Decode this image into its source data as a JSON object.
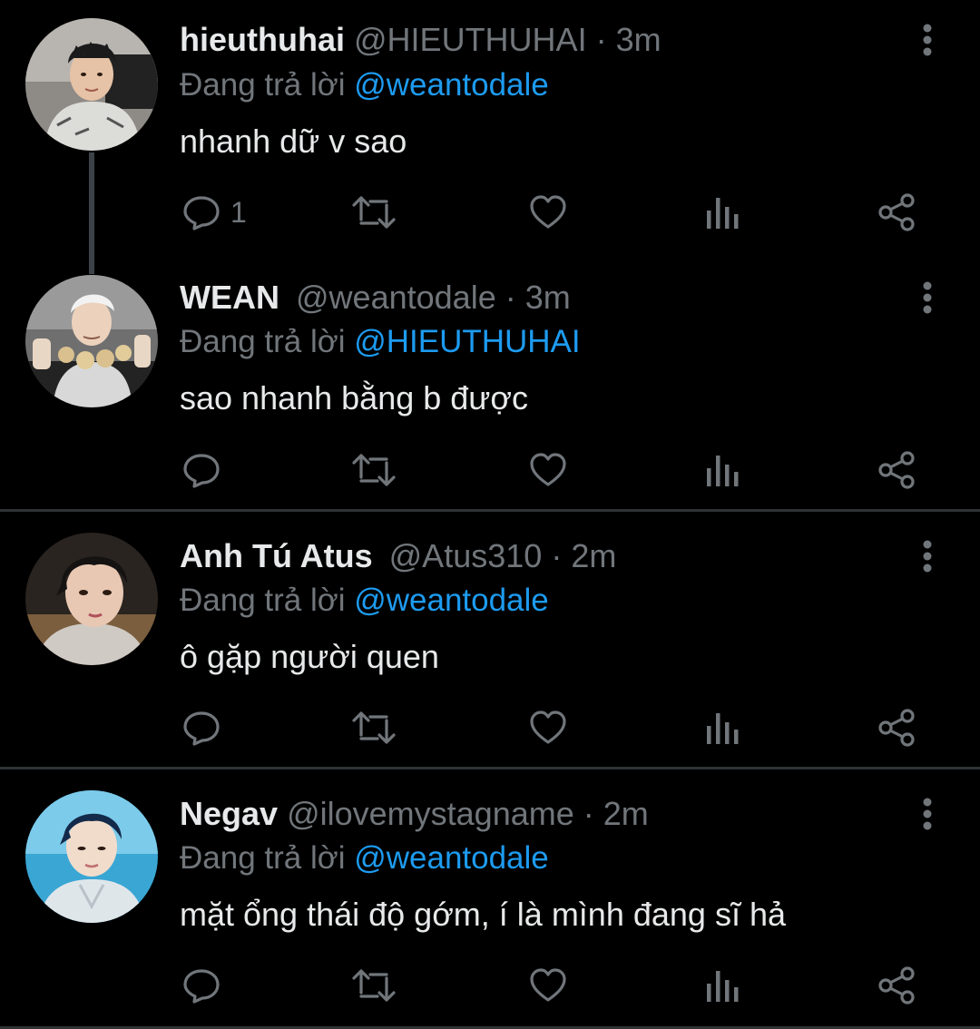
{
  "reply_prefix": "Đang trả lời",
  "separator": "·",
  "colors": {
    "background": "#000000",
    "text": "#e7e9ea",
    "secondary": "#71767b",
    "mention": "#1d9bf0",
    "divider": "#2f3336"
  },
  "icons": [
    "more-vertical-icon",
    "reply-icon",
    "retweet-icon",
    "like-icon",
    "analytics-icon",
    "share-icon"
  ],
  "tweets": [
    {
      "name": "hieuthuhai",
      "handle": "@HIEUTHUHAI",
      "time": "3m",
      "reply_to": "@weantodale",
      "text": "nhanh dữ v sao",
      "reply_count": "1"
    },
    {
      "name": "WEAN",
      "handle": "@weantodale",
      "time": "3m",
      "reply_to": "@HIEUTHUHAI",
      "text": "sao nhanh bằng b được",
      "reply_count": ""
    },
    {
      "name": "Anh Tú Atus",
      "handle": "@Atus310",
      "time": "2m",
      "reply_to": "@weantodale",
      "text": "ô gặp người quen",
      "reply_count": ""
    },
    {
      "name": "Negav",
      "handle": "@ilovemystagname",
      "time": "2m",
      "reply_to": "@weantodale",
      "text": "mặt ổng thái độ gớm, í là mình đang sĩ hả",
      "reply_count": ""
    }
  ]
}
